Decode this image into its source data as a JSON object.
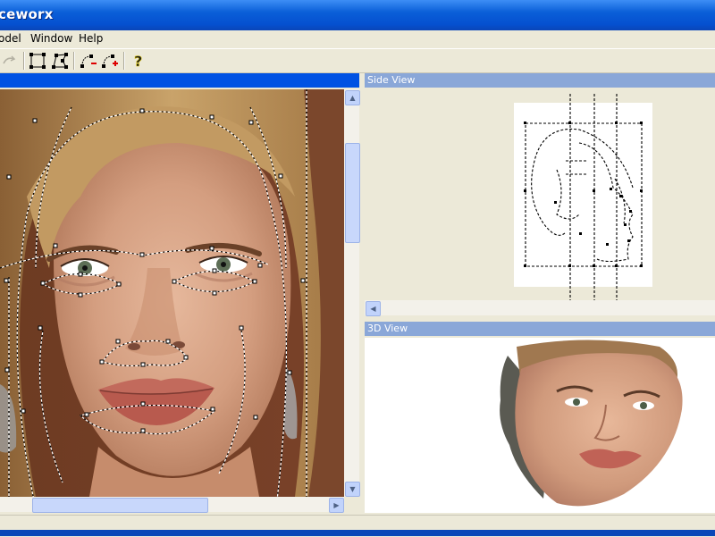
{
  "app": {
    "title": "ceworx"
  },
  "menu": {
    "items": [
      "odel",
      "Window",
      "Help"
    ]
  },
  "toolbar": {
    "buttons": [
      {
        "icon": "redo-icon",
        "enabled": false
      },
      {
        "icon": "select-rect-icon",
        "enabled": true
      },
      {
        "icon": "select-polygon-icon",
        "enabled": true
      },
      {
        "icon": "curve-remove-point-icon",
        "enabled": true
      },
      {
        "icon": "curve-add-point-icon",
        "enabled": true
      },
      {
        "icon": "help-icon",
        "enabled": true
      }
    ]
  },
  "panes": {
    "front": {
      "title": ""
    },
    "side": {
      "title": "Side View"
    },
    "threed": {
      "title": "3D View"
    }
  },
  "colors": {
    "title_bar": "#0a5fd8",
    "active_pane": "#0052e3",
    "inactive_pane": "#8aa7d8",
    "workspace": "#ece9d8"
  }
}
